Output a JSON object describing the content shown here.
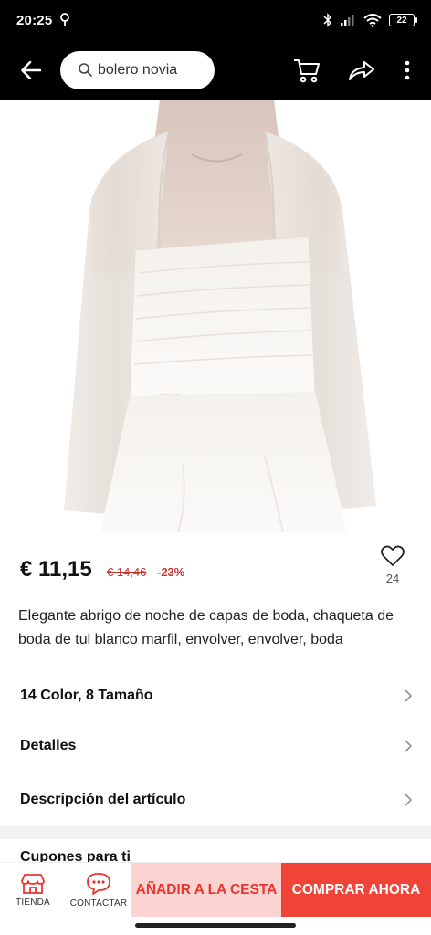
{
  "status_bar": {
    "time": "20:25",
    "battery": "22"
  },
  "top_nav": {
    "search_value": "bolero novia"
  },
  "product": {
    "price": "€ 11,15",
    "original_price": "€ 14,46",
    "discount": "-23%",
    "wishlist_count": "24",
    "title": "Elegante abrigo de noche de capas de boda, chaqueta de boda de tul blanco marfil, envolver, envolver, boda"
  },
  "options": {
    "variants_label": "14 Color, 8 Tamaño",
    "details_label": "Detalles",
    "description_label": "Descripción del artículo",
    "coupons_label": "Cupones para ti"
  },
  "bottom_bar": {
    "store_label": "TIENDA",
    "contact_label": "CONTACTAR",
    "add_to_cart_label": "AÑADIR A LA CESTA",
    "buy_now_label": "COMPRAR AHORA"
  },
  "icons": {
    "back": "arrow-left-icon",
    "search": "search-icon",
    "cart": "cart-icon",
    "share": "share-icon",
    "more": "more-vertical-icon",
    "wishlist": "heart-icon",
    "chevron": "chevron-right-icon",
    "store": "store-icon",
    "contact": "chat-icon"
  },
  "colors": {
    "accent": "#f04438",
    "accent_light": "#fbd3d1",
    "price_red": "#c9302c",
    "nav_bg": "#000000"
  }
}
